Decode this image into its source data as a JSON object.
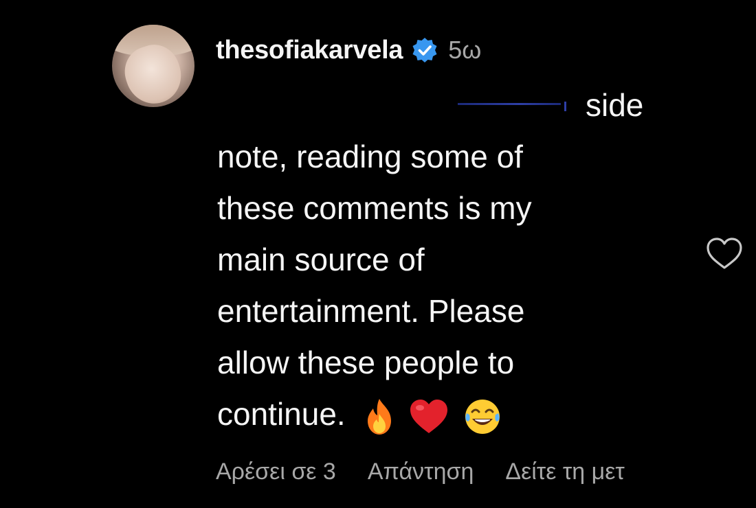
{
  "comment": {
    "username": "thesofiakarvela",
    "verified": true,
    "time": "5ω",
    "text_lines": [
      "side",
      "note, reading some of",
      "these comments is my",
      "main source of",
      "entertainment. Please",
      "allow these people to",
      "continue."
    ],
    "emojis": [
      "fire-emoji",
      "red-heart-emoji",
      "tears-of-joy-emoji"
    ]
  },
  "actions": {
    "likes": "Αρέσει σε 3",
    "reply": "Απάντηση",
    "see_translation": "Δείτε τη μετ"
  },
  "icons": {
    "like": "heart-outline-icon",
    "verified": "verified-badge-icon"
  },
  "colors": {
    "background": "#000000",
    "text": "#f5f5f5",
    "secondary_text": "#a8a8a8",
    "verified_blue": "#3897f0"
  }
}
